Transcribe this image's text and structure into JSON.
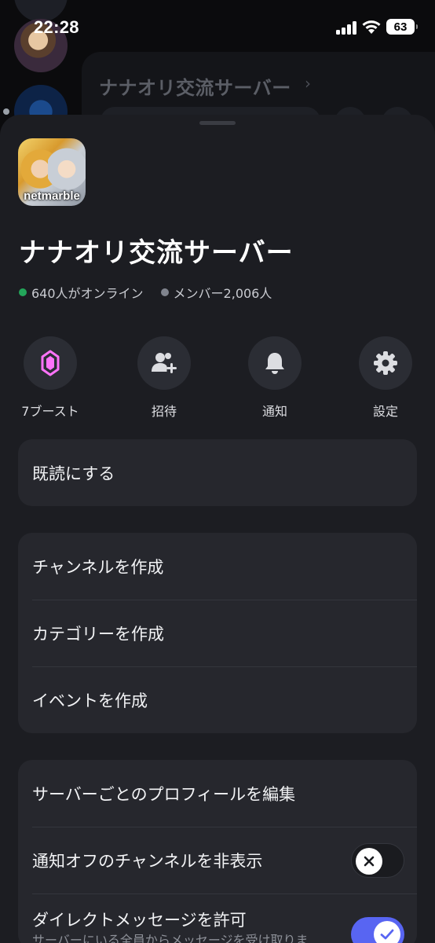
{
  "status_bar": {
    "time": "22:28",
    "battery": "63",
    "signal_icon": "cellular-signal-icon",
    "wifi_icon": "wifi-icon"
  },
  "background": {
    "server_title": "ナナオリ交流サーバー",
    "chevron": "›"
  },
  "sheet": {
    "server_icon_brand": "netmarble",
    "server_name": "ナナオリ交流サーバー",
    "online_text": "640人がオンライン",
    "member_text": "メンバー2,006人",
    "colors": {
      "online": "#23a55a",
      "member": "#80848e",
      "boost": "#ff73fa",
      "accent": "#5865f2"
    },
    "actions": [
      {
        "label": "7ブースト",
        "icon": "boost-gem-icon"
      },
      {
        "label": "招待",
        "icon": "invite-user-icon"
      },
      {
        "label": "通知",
        "icon": "bell-icon"
      },
      {
        "label": "設定",
        "icon": "gear-icon"
      }
    ],
    "group1": [
      {
        "label": "既読にする"
      }
    ],
    "group2": [
      {
        "label": "チャンネルを作成"
      },
      {
        "label": "カテゴリーを作成"
      },
      {
        "label": "イベントを作成"
      }
    ],
    "group3": {
      "edit_profile": "サーバーごとのプロフィールを編集",
      "hide_muted": {
        "label": "通知オフのチャンネルを非表示",
        "enabled": false
      },
      "allow_dm": {
        "label": "ダイレクトメッセージを許可",
        "sub": "サーバーにいる全員からメッセージを受け取りま",
        "enabled": true
      }
    }
  }
}
